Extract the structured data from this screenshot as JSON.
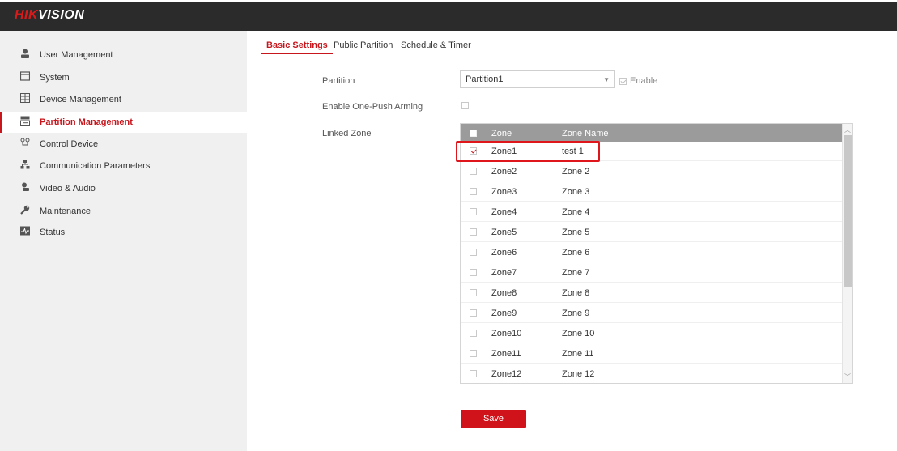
{
  "app": {
    "logo_brand": "HIK",
    "logo_rest": "VISION"
  },
  "sidebar": {
    "items": [
      {
        "label": "User Management",
        "icon": "user-icon"
      },
      {
        "label": "System",
        "icon": "system-icon"
      },
      {
        "label": "Device Management",
        "icon": "device-icon"
      },
      {
        "label": "Partition Management",
        "icon": "partition-icon",
        "active": true
      },
      {
        "label": "Control Device",
        "icon": "control-icon"
      },
      {
        "label": "Communication Parameters",
        "icon": "network-icon"
      },
      {
        "label": "Video & Audio",
        "icon": "camera-icon"
      },
      {
        "label": "Maintenance",
        "icon": "wrench-icon"
      },
      {
        "label": "Status",
        "icon": "status-icon"
      }
    ]
  },
  "tabs": [
    {
      "label": "Basic Settings",
      "active": true
    },
    {
      "label": "Public Partition"
    },
    {
      "label": "Schedule & Timer"
    }
  ],
  "form": {
    "partition_label": "Partition",
    "partition_value": "Partition1",
    "enable_label": "Enable",
    "enable_checked": true,
    "one_push_label": "Enable One-Push Arming",
    "one_push_checked": false,
    "linked_zone_label": "Linked Zone"
  },
  "zones": {
    "header_zone": "Zone",
    "header_name": "Zone Name",
    "rows": [
      {
        "zone": "Zone1",
        "name": "test 1",
        "checked": true
      },
      {
        "zone": "Zone2",
        "name": "Zone 2",
        "checked": false
      },
      {
        "zone": "Zone3",
        "name": "Zone 3",
        "checked": false
      },
      {
        "zone": "Zone4",
        "name": "Zone 4",
        "checked": false
      },
      {
        "zone": "Zone5",
        "name": "Zone 5",
        "checked": false
      },
      {
        "zone": "Zone6",
        "name": "Zone 6",
        "checked": false
      },
      {
        "zone": "Zone7",
        "name": "Zone 7",
        "checked": false
      },
      {
        "zone": "Zone8",
        "name": "Zone 8",
        "checked": false
      },
      {
        "zone": "Zone9",
        "name": "Zone 9",
        "checked": false
      },
      {
        "zone": "Zone10",
        "name": "Zone 10",
        "checked": false
      },
      {
        "zone": "Zone11",
        "name": "Zone 11",
        "checked": false
      },
      {
        "zone": "Zone12",
        "name": "Zone 12",
        "checked": false
      }
    ]
  },
  "actions": {
    "save_label": "Save"
  },
  "colors": {
    "accent": "#c8161d",
    "topbar": "#2b2b2b",
    "sidebar": "#f0f0f0",
    "table_header": "#9b9b9b"
  }
}
